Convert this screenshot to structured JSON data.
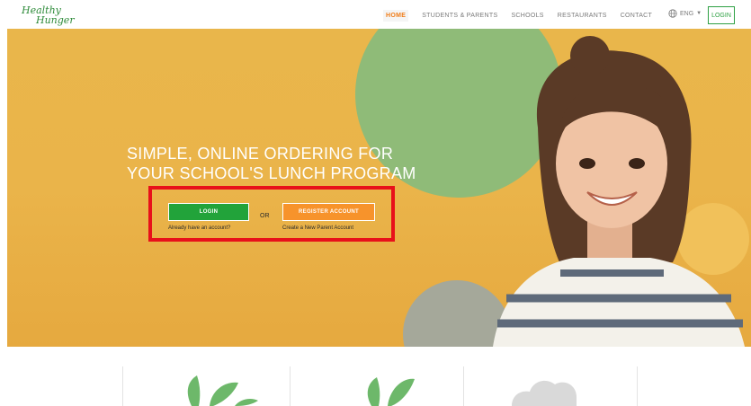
{
  "nav": {
    "logo_line1": "Healthy",
    "logo_line2": "Hunger",
    "items": [
      {
        "label": "HOME",
        "active": true
      },
      {
        "label": "STUDENTS & PARENTS",
        "active": false
      },
      {
        "label": "SCHOOLS",
        "active": false
      },
      {
        "label": "RESTAURANTS",
        "active": false
      },
      {
        "label": "CONTACT",
        "active": false
      }
    ],
    "language": "ENG",
    "login_label": "LOGIN"
  },
  "hero": {
    "headline_line1": "SIMPLE, ONLINE ORDERING FOR",
    "headline_line2": "YOUR SCHOOL'S LUNCH PROGRAM",
    "login_button": "LOGIN",
    "or_text": "OR",
    "register_button": "REGISTER ACCOUNT",
    "login_sub": "Already have an account?",
    "register_sub": "Create a New Parent Account"
  },
  "colors": {
    "accent_green": "#22a33a",
    "accent_orange": "#f7932b",
    "hero_yellow": "#e9b64b",
    "highlight_red": "#e8101a"
  },
  "icons": [
    "globe-icon",
    "caret-down-icon",
    "leaf-icon",
    "cloud-icon"
  ]
}
